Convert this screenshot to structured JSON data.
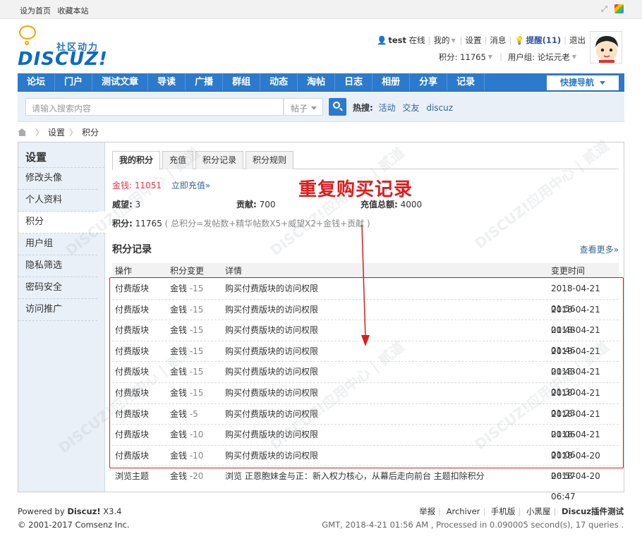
{
  "topbar": {
    "set_home": "设为首页",
    "bookmark": "收藏本站"
  },
  "logo": {
    "cn": "社区动力",
    "en": "DISCUZ!"
  },
  "user": {
    "name": "test",
    "status": "在线",
    "mine": "我的",
    "settings": "设置",
    "messages": "消息",
    "remind": "提醒(11)",
    "logout": "退出",
    "points_label": "积分: 11765",
    "group_label": "用户组: 论坛元老"
  },
  "nav": {
    "items": [
      "论坛",
      "门户",
      "测试文章",
      "导读",
      "广播",
      "群组",
      "动态",
      "淘帖",
      "日志",
      "相册",
      "分享",
      "记录"
    ],
    "quick": "快捷导航"
  },
  "search": {
    "placeholder": "请输入搜索内容",
    "type": "帖子",
    "hot_label": "热搜:",
    "hot_words": [
      "活动",
      "交友",
      "discuz"
    ]
  },
  "breadcrumb": {
    "items": [
      "设置",
      "积分"
    ]
  },
  "sidebar": {
    "title": "设置",
    "items": [
      "修改头像",
      "个人资料",
      "积分",
      "用户组",
      "隐私筛选",
      "密码安全",
      "访问推广"
    ]
  },
  "tabs": [
    "我的积分",
    "充值",
    "积分记录",
    "积分规则"
  ],
  "summary": {
    "coins_label": "金钱:",
    "coins_value": "11051",
    "recharge": "立即充值»",
    "prestige_label": "威望:",
    "prestige_value": "3",
    "contrib_label": "贡献:",
    "contrib_value": "700",
    "recharge_total_label": "充值总额:",
    "recharge_total_value": "4000",
    "points_label": "积分:",
    "points_value": "11765",
    "formula": "( 总积分=发帖数+精华帖数X5+威望X2+金钱+贡献 )"
  },
  "records": {
    "title": "积分记录",
    "view_more": "查看更多»",
    "headers": [
      "操作",
      "积分变更",
      "详情",
      "变更时间"
    ],
    "rows": [
      {
        "op": "付费版块",
        "unit": "金钱",
        "amt": "-15",
        "detail": "购买付费版块的访问权限",
        "time": "2018-04-21 01:56"
      },
      {
        "op": "付费版块",
        "unit": "金钱",
        "amt": "-15",
        "detail": "购买付费版块的访问权限",
        "time": "2018-04-21 01:48"
      },
      {
        "op": "付费版块",
        "unit": "金钱",
        "amt": "-15",
        "detail": "购买付费版块的访问权限",
        "time": "2018-04-21 01:46"
      },
      {
        "op": "付费版块",
        "unit": "金钱",
        "amt": "-15",
        "detail": "购买付费版块的访问权限",
        "time": "2018-04-21 01:43"
      },
      {
        "op": "付费版块",
        "unit": "金钱",
        "amt": "-15",
        "detail": "购买付费版块的访问权限",
        "time": "2018-04-21 01:30"
      },
      {
        "op": "付费版块",
        "unit": "金钱",
        "amt": "-15",
        "detail": "购买付费版块的访问权限",
        "time": "2018-04-21 01:23"
      },
      {
        "op": "付费版块",
        "unit": "金钱",
        "amt": "-5",
        "detail": "购买付费版块的访问权限",
        "time": "2018-04-21 01:06"
      },
      {
        "op": "付费版块",
        "unit": "金钱",
        "amt": "-10",
        "detail": "购买付费版块的访问权限",
        "time": "2018-04-21 01:06"
      },
      {
        "op": "付费版块",
        "unit": "金钱",
        "amt": "-10",
        "detail": "购买付费版块的访问权限",
        "time": "2018-04-20 06:57"
      },
      {
        "op": "浏览主题",
        "unit": "金钱",
        "amt": "-20",
        "detail": "浏览 正恩胞妹金与正：新入权力核心，从幕后走向前台 主题扣除积分",
        "time": "2018-04-20 06:47"
      }
    ]
  },
  "annotation": {
    "text": "重复购买记录",
    "color": "#e01b1b"
  },
  "watermark": {
    "text": "DISCUZ!应用中心 | 贰道",
    "sub": "addon.discuz.com"
  },
  "footer": {
    "powered": "Powered by",
    "brand": "Discuz!",
    "version": "X3.4",
    "copyright": "© 2001-2017 Comsenz Inc.",
    "links": [
      "举报",
      "Archiver",
      "手机版",
      "小黑屋"
    ],
    "site": "Discuz插件测试",
    "gmt": "GMT, 2018-4-21 01:56 AM , Processed in 0.090005 second(s), 17 queries ."
  },
  "colors": {
    "nav": "#2b7acd",
    "link": "#336699",
    "coins": "#e34"
  }
}
